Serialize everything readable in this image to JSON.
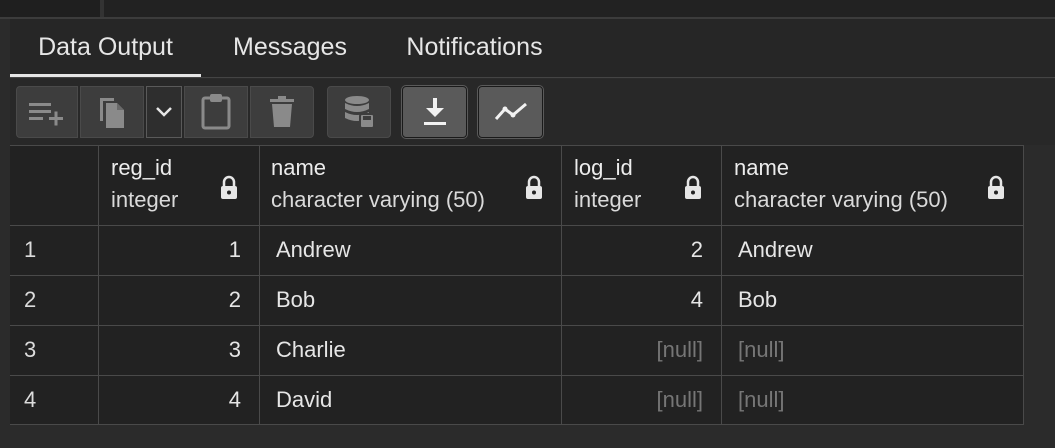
{
  "tabs": [
    {
      "label": "Data Output"
    },
    {
      "label": "Messages"
    },
    {
      "label": "Notifications"
    }
  ],
  "toolbar": {
    "icons": [
      "add-row-icon",
      "copy-icon",
      "chevron-down-icon",
      "paste-icon",
      "delete-icon",
      "save-data-icon",
      "download-icon",
      "graph-icon"
    ]
  },
  "columns": [
    {
      "name": "reg_id",
      "type": "integer"
    },
    {
      "name": "name",
      "type": "character varying (50)"
    },
    {
      "name": "log_id",
      "type": "integer"
    },
    {
      "name": "name",
      "type": "character varying (50)"
    }
  ],
  "rows": [
    {
      "num": "1",
      "cells": [
        "1",
        "Andrew",
        "2",
        "Andrew"
      ]
    },
    {
      "num": "2",
      "cells": [
        "2",
        "Bob",
        "4",
        "Bob"
      ]
    },
    {
      "num": "3",
      "cells": [
        "3",
        "Charlie",
        "[null]",
        "[null]"
      ]
    },
    {
      "num": "4",
      "cells": [
        "4",
        "David",
        "[null]",
        "[null]"
      ]
    }
  ],
  "colors": {
    "background": "#2b2b2b",
    "grid": "#222222",
    "null_text": "#767676",
    "text": "#e6e6e6"
  }
}
